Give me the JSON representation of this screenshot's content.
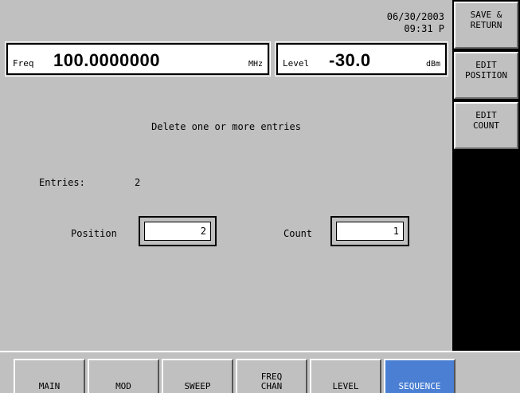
{
  "header": {
    "date": "06/30/2003",
    "time": "09:31 P"
  },
  "freq": {
    "label": "Freq",
    "value": "100.0000000",
    "unit": "MHz"
  },
  "level": {
    "label": "Level",
    "value": "-30.0",
    "unit": "dBm"
  },
  "message": "Delete one or more entries",
  "entries": {
    "label": "Entries:",
    "value": "2"
  },
  "position": {
    "label": "Position",
    "value": "2"
  },
  "count": {
    "label": "Count",
    "value": "1"
  },
  "softkeys": [
    {
      "label": "SAVE &\nRETURN"
    },
    {
      "label": "EDIT\nPOSITION"
    },
    {
      "label": "EDIT\nCOUNT"
    },
    {
      "label": ""
    },
    {
      "label": ""
    },
    {
      "label": ""
    },
    {
      "label": ""
    }
  ],
  "tabs": [
    {
      "label": "MAIN"
    },
    {
      "label": "MOD"
    },
    {
      "label": "SWEEP"
    },
    {
      "label": "FREQ\nCHAN"
    },
    {
      "label": "LEVEL"
    },
    {
      "label": "SEQUENCE",
      "active": true
    }
  ],
  "colors": {
    "background": "#c0c0c0",
    "active_tab": "#4a7fd4"
  }
}
